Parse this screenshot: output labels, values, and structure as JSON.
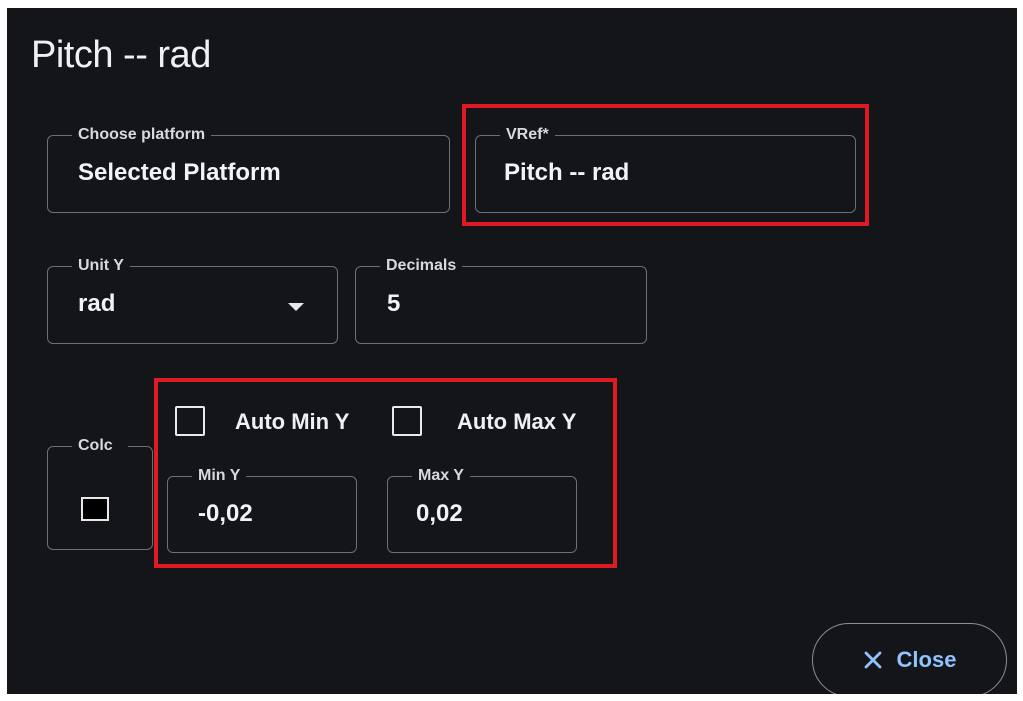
{
  "dialog": {
    "title": "Pitch -- rad"
  },
  "platform": {
    "label": "Choose platform",
    "value": "Selected Platform"
  },
  "vref": {
    "label": "VRef*",
    "value": "Pitch -- rad"
  },
  "unit_y": {
    "label": "Unit Y",
    "value": "rad"
  },
  "decimals": {
    "label": "Decimals",
    "value": "5"
  },
  "color": {
    "label": "Colc",
    "swatch": "#000000"
  },
  "auto_min": {
    "label": "Auto Min Y",
    "checked": false
  },
  "auto_max": {
    "label": "Auto Max Y",
    "checked": false
  },
  "min_y": {
    "label": "Min Y",
    "value": "-0,02"
  },
  "max_y": {
    "label": "Max Y",
    "value": "0,02"
  },
  "footer": {
    "close_label": "Close",
    "close_icon": "close-icon"
  },
  "colors": {
    "background": "#131519",
    "highlight": "#e01a22",
    "accent": "#8fc2ff"
  }
}
